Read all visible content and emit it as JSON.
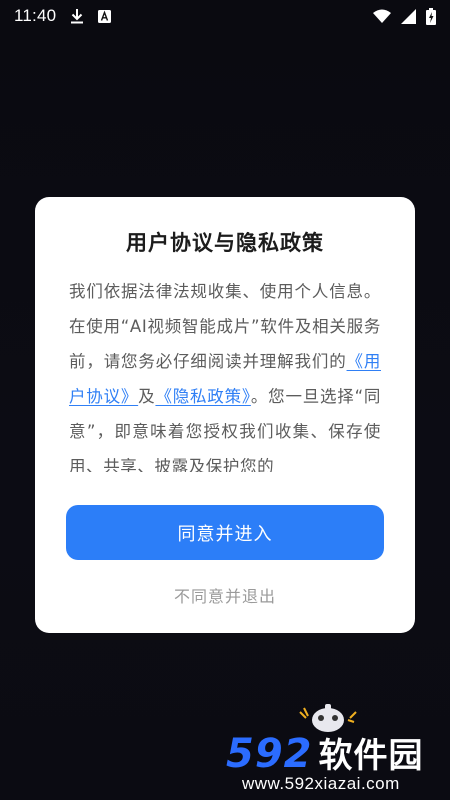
{
  "status_bar": {
    "time": "11:40",
    "left_icons": [
      "download-icon",
      "keyboard-a-icon"
    ],
    "right_icons": [
      "wifi-icon",
      "signal-icon",
      "battery-charging-icon"
    ]
  },
  "dialog": {
    "title": "用户协议与隐私政策",
    "body_intro": "我们依据法律法规收集、使用个人信息。在使用“AI视频智能成片”软件及相关服务前，请您务必仔细阅读并理解我们的",
    "link_user_agreement": "《用户协议》",
    "connector": "及",
    "link_privacy_policy": "《隐私政策》",
    "body_rest": "。您一旦选择“同意”，即意味着您授权我们收集、保存使用、共享、披露及保护您的",
    "agree_label": "同意并进入",
    "disagree_label": "不同意并退出"
  },
  "watermark": {
    "brand_number": "592",
    "brand_text": "软件园",
    "url": "www.592xiazai.com",
    "mascot_icon": "game-controller-mascot-icon"
  },
  "colors": {
    "background": "#0b0b12",
    "dialog_bg": "#ffffff",
    "primary_button": "#2c7ef8",
    "link": "#2f7ff5",
    "body_text": "#5c5c5c",
    "title_text": "#1c1c1c",
    "secondary_text": "#9a9a9a"
  }
}
